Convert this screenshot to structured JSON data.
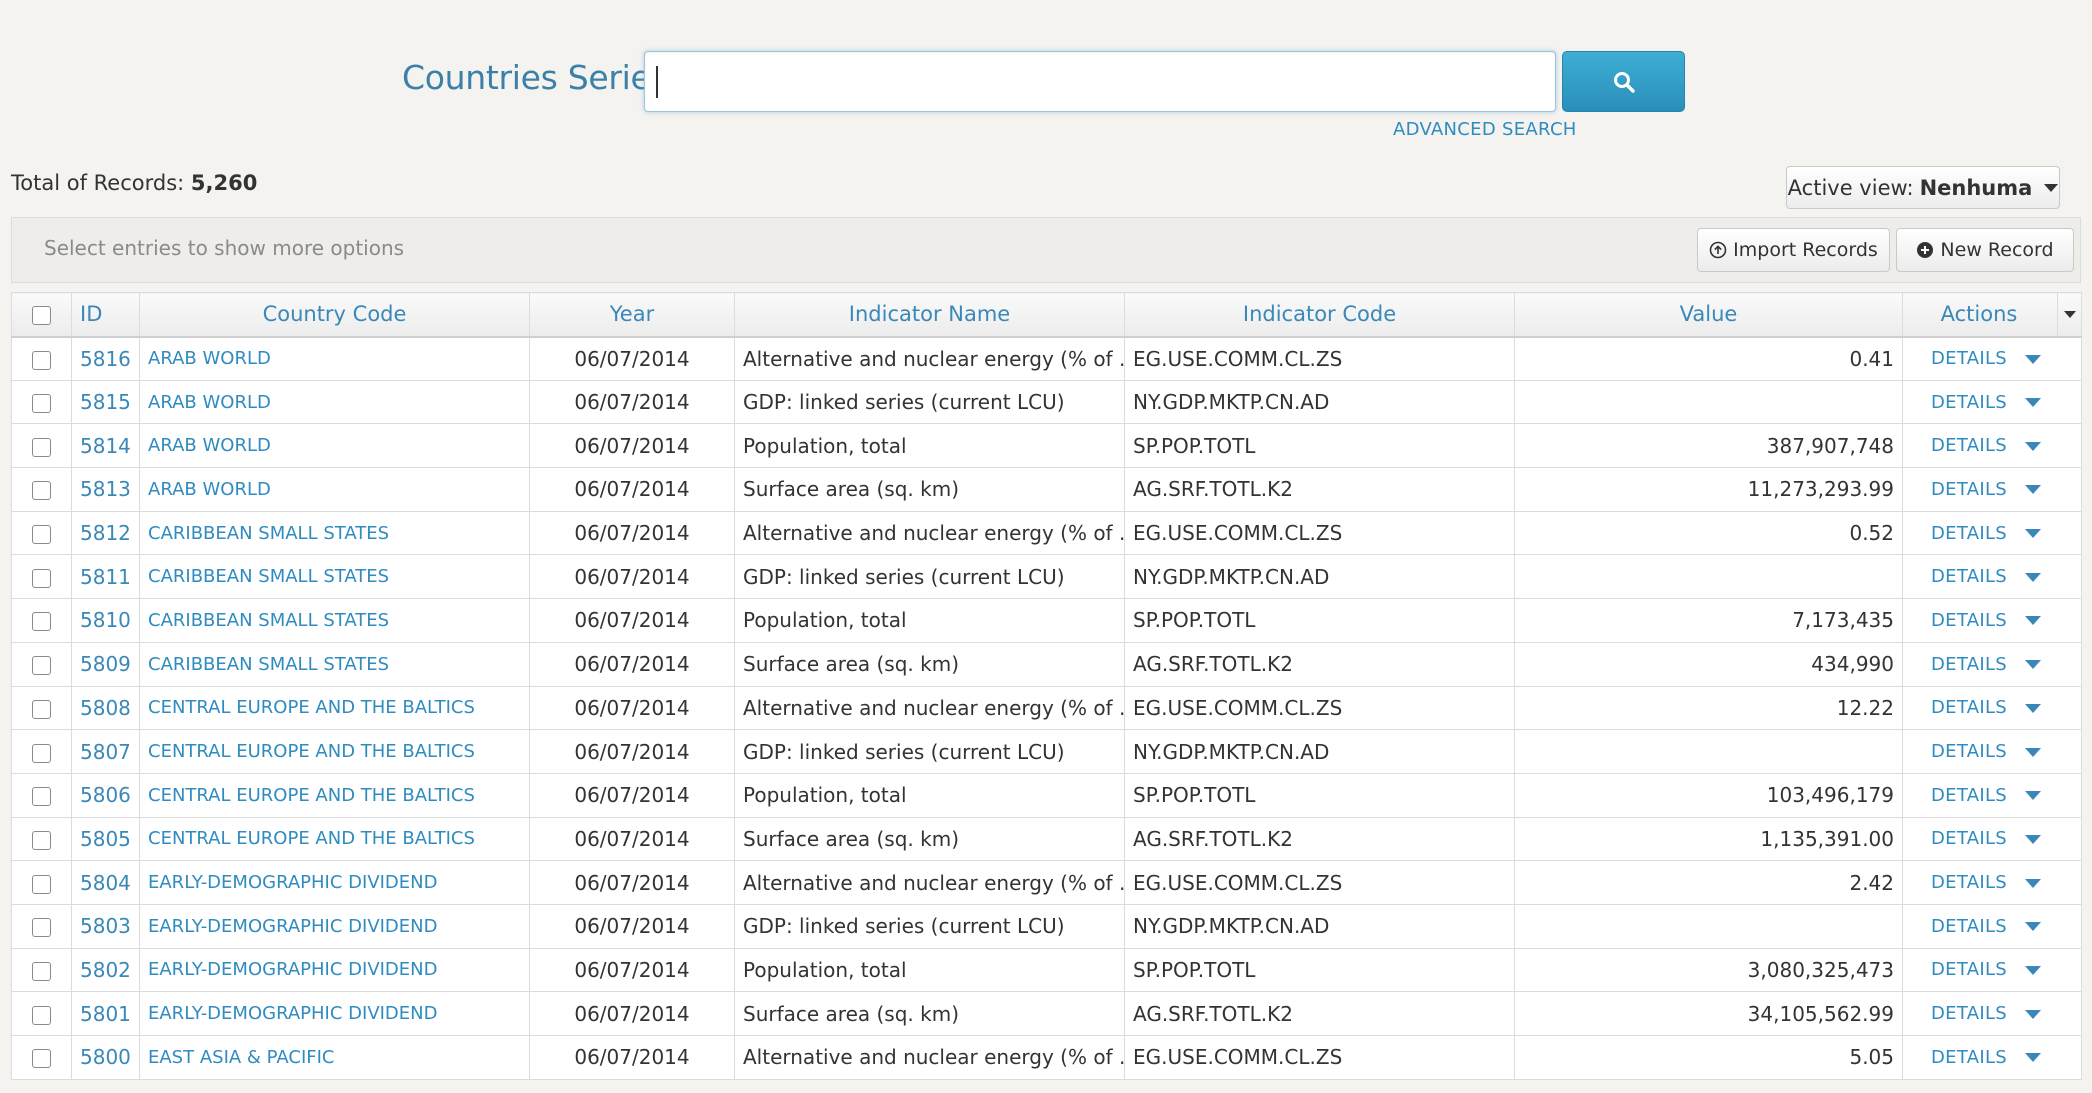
{
  "search": {
    "title": "Countries Series",
    "input_value": "",
    "advanced_label": "ADVANCED SEARCH"
  },
  "records": {
    "total_label": "Total of Records:",
    "total_value": "5,260",
    "active_view_label": "Active view:",
    "active_view_value": "Nenhuma"
  },
  "toolbar": {
    "hint": "Select entries to show more options",
    "import_label": "Import Records",
    "new_label": "New Record"
  },
  "table": {
    "columns": [
      "ID",
      "Country Code",
      "Year",
      "Indicator Name",
      "Indicator Code",
      "Value",
      "Actions"
    ],
    "details_label": "DETAILS",
    "rows": [
      {
        "id": "5816",
        "country": "ARAB WORLD",
        "year": "06/07/2014",
        "indicator_name": "Alternative and nuclear energy (% of ...",
        "indicator_code": "EG.USE.COMM.CL.ZS",
        "value": "0.41"
      },
      {
        "id": "5815",
        "country": "ARAB WORLD",
        "year": "06/07/2014",
        "indicator_name": "GDP: linked series (current LCU)",
        "indicator_code": "NY.GDP.MKTP.CN.AD",
        "value": ""
      },
      {
        "id": "5814",
        "country": "ARAB WORLD",
        "year": "06/07/2014",
        "indicator_name": "Population, total",
        "indicator_code": "SP.POP.TOTL",
        "value": "387,907,748"
      },
      {
        "id": "5813",
        "country": "ARAB WORLD",
        "year": "06/07/2014",
        "indicator_name": "Surface area (sq. km)",
        "indicator_code": "AG.SRF.TOTL.K2",
        "value": "11,273,293.99"
      },
      {
        "id": "5812",
        "country": "CARIBBEAN SMALL STATES",
        "year": "06/07/2014",
        "indicator_name": "Alternative and nuclear energy (% of ...",
        "indicator_code": "EG.USE.COMM.CL.ZS",
        "value": "0.52"
      },
      {
        "id": "5811",
        "country": "CARIBBEAN SMALL STATES",
        "year": "06/07/2014",
        "indicator_name": "GDP: linked series (current LCU)",
        "indicator_code": "NY.GDP.MKTP.CN.AD",
        "value": ""
      },
      {
        "id": "5810",
        "country": "CARIBBEAN SMALL STATES",
        "year": "06/07/2014",
        "indicator_name": "Population, total",
        "indicator_code": "SP.POP.TOTL",
        "value": "7,173,435"
      },
      {
        "id": "5809",
        "country": "CARIBBEAN SMALL STATES",
        "year": "06/07/2014",
        "indicator_name": "Surface area (sq. km)",
        "indicator_code": "AG.SRF.TOTL.K2",
        "value": "434,990"
      },
      {
        "id": "5808",
        "country": "CENTRAL EUROPE AND THE BALTICS",
        "year": "06/07/2014",
        "indicator_name": "Alternative and nuclear energy (% of ...",
        "indicator_code": "EG.USE.COMM.CL.ZS",
        "value": "12.22"
      },
      {
        "id": "5807",
        "country": "CENTRAL EUROPE AND THE BALTICS",
        "year": "06/07/2014",
        "indicator_name": "GDP: linked series (current LCU)",
        "indicator_code": "NY.GDP.MKTP.CN.AD",
        "value": ""
      },
      {
        "id": "5806",
        "country": "CENTRAL EUROPE AND THE BALTICS",
        "year": "06/07/2014",
        "indicator_name": "Population, total",
        "indicator_code": "SP.POP.TOTL",
        "value": "103,496,179"
      },
      {
        "id": "5805",
        "country": "CENTRAL EUROPE AND THE BALTICS",
        "year": "06/07/2014",
        "indicator_name": "Surface area (sq. km)",
        "indicator_code": "AG.SRF.TOTL.K2",
        "value": "1,135,391.00"
      },
      {
        "id": "5804",
        "country": "EARLY-DEMOGRAPHIC DIVIDEND",
        "year": "06/07/2014",
        "indicator_name": "Alternative and nuclear energy (% of ...",
        "indicator_code": "EG.USE.COMM.CL.ZS",
        "value": "2.42"
      },
      {
        "id": "5803",
        "country": "EARLY-DEMOGRAPHIC DIVIDEND",
        "year": "06/07/2014",
        "indicator_name": "GDP: linked series (current LCU)",
        "indicator_code": "NY.GDP.MKTP.CN.AD",
        "value": ""
      },
      {
        "id": "5802",
        "country": "EARLY-DEMOGRAPHIC DIVIDEND",
        "year": "06/07/2014",
        "indicator_name": "Population, total",
        "indicator_code": "SP.POP.TOTL",
        "value": "3,080,325,473"
      },
      {
        "id": "5801",
        "country": "EARLY-DEMOGRAPHIC DIVIDEND",
        "year": "06/07/2014",
        "indicator_name": "Surface area (sq. km)",
        "indicator_code": "AG.SRF.TOTL.K2",
        "value": "34,105,562.99"
      },
      {
        "id": "5800",
        "country": "EAST ASIA & PACIFIC",
        "year": "06/07/2014",
        "indicator_name": "Alternative and nuclear energy (% of ...",
        "indicator_code": "EG.USE.COMM.CL.ZS",
        "value": "5.05"
      }
    ]
  },
  "icons": {
    "search": "search-icon",
    "import": "circle-arrow-up-icon",
    "new": "circle-plus-icon",
    "dropdown": "chevron-down-icon"
  },
  "colors": {
    "accent": "#3a88b8",
    "link": "#2f8bc0",
    "search_button": "#3eaed3",
    "background": "#f4f3f0"
  }
}
